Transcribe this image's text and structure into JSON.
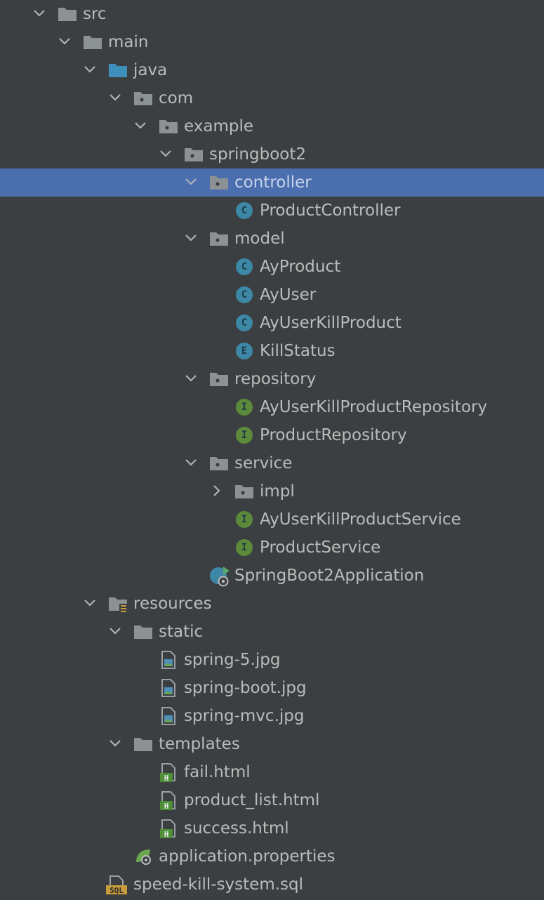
{
  "colors": {
    "background": "#3c3f41",
    "selection": "#4b6eaf",
    "text": "#bbbbbb",
    "folder": "#8c9194",
    "source_folder": "#3f8fbc",
    "class_icon": "#3d88a6",
    "interface_icon": "#5b8a3a",
    "enum_icon": "#3d88a6"
  },
  "tree": [
    {
      "label": "src",
      "expanded": true,
      "icon": "folder-icon"
    },
    {
      "label": "main",
      "expanded": true,
      "icon": "folder-icon"
    },
    {
      "label": "java",
      "expanded": true,
      "icon": "source-folder-icon"
    },
    {
      "label": "com",
      "expanded": true,
      "icon": "package-icon"
    },
    {
      "label": "example",
      "expanded": true,
      "icon": "package-icon"
    },
    {
      "label": "springboot2",
      "expanded": true,
      "icon": "package-icon"
    },
    {
      "label": "controller",
      "expanded": true,
      "selected": true,
      "icon": "package-icon"
    },
    {
      "label": "ProductController",
      "icon": "class-icon",
      "letter": "C"
    },
    {
      "label": "model",
      "expanded": true,
      "icon": "package-icon"
    },
    {
      "label": "AyProduct",
      "icon": "class-icon",
      "letter": "C"
    },
    {
      "label": "AyUser",
      "icon": "class-icon",
      "letter": "C"
    },
    {
      "label": "AyUserKillProduct",
      "icon": "class-icon",
      "letter": "C"
    },
    {
      "label": "KillStatus",
      "icon": "enum-icon",
      "letter": "E"
    },
    {
      "label": "repository",
      "expanded": true,
      "icon": "package-icon"
    },
    {
      "label": "AyUserKillProductRepository",
      "icon": "interface-icon",
      "letter": "I"
    },
    {
      "label": "ProductRepository",
      "icon": "interface-icon",
      "letter": "I"
    },
    {
      "label": "service",
      "expanded": true,
      "icon": "package-icon"
    },
    {
      "label": "impl",
      "expanded": false,
      "icon": "package-icon"
    },
    {
      "label": "AyUserKillProductService",
      "icon": "interface-icon",
      "letter": "I"
    },
    {
      "label": "ProductService",
      "icon": "interface-icon",
      "letter": "I"
    },
    {
      "label": "SpringBoot2Application",
      "icon": "spring-boot-app-icon",
      "letter": "C"
    },
    {
      "label": "resources",
      "expanded": true,
      "icon": "resources-folder-icon"
    },
    {
      "label": "static",
      "expanded": true,
      "icon": "folder-icon"
    },
    {
      "label": "spring-5.jpg",
      "icon": "image-file-icon"
    },
    {
      "label": "spring-boot.jpg",
      "icon": "image-file-icon"
    },
    {
      "label": "spring-mvc.jpg",
      "icon": "image-file-icon"
    },
    {
      "label": "templates",
      "expanded": true,
      "icon": "folder-icon"
    },
    {
      "label": "fail.html",
      "icon": "html-file-icon",
      "letter": "H"
    },
    {
      "label": "product_list.html",
      "icon": "html-file-icon",
      "letter": "H"
    },
    {
      "label": "success.html",
      "icon": "html-file-icon",
      "letter": "H"
    },
    {
      "label": "application.properties",
      "icon": "spring-properties-icon"
    },
    {
      "label": "speed-kill-system.sql",
      "icon": "sql-file-icon",
      "letter": "SQL"
    }
  ]
}
